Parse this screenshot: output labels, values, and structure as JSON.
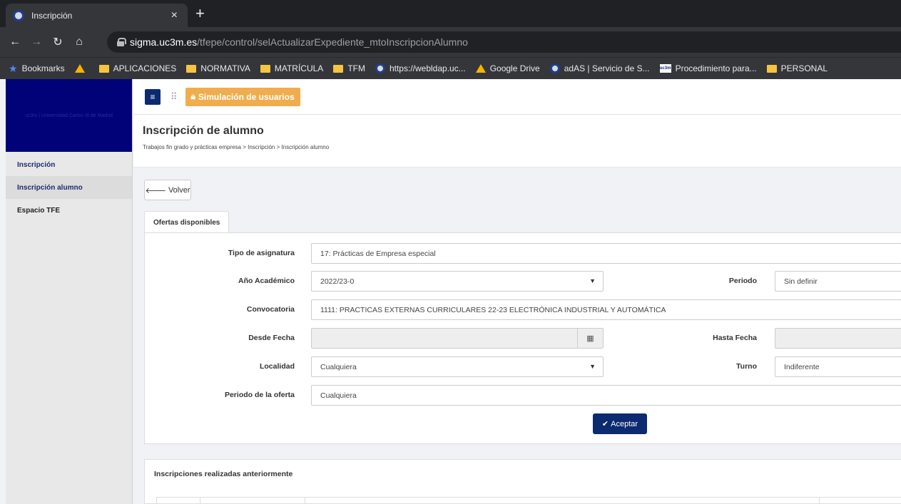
{
  "browser": {
    "tab_title": "Inscripción",
    "close_glyph": "×",
    "newtab_glyph": "+",
    "url_host": "sigma.uc3m.es",
    "url_path": "/tfepe/control/selActualizarExpediente_mtoInscripcionAlumno",
    "bookmarks": [
      {
        "label": "Bookmarks",
        "icon": "star-icon"
      },
      {
        "label": "",
        "icon": "google-drive-icon"
      },
      {
        "label": "APLICACIONES",
        "icon": "folder-icon"
      },
      {
        "label": "NORMATIVA",
        "icon": "folder-icon"
      },
      {
        "label": "MATRÍCULA",
        "icon": "folder-icon"
      },
      {
        "label": "TFM",
        "icon": "folder-icon"
      },
      {
        "label": "https://webldap.uc...",
        "icon": "globe-icon"
      },
      {
        "label": "Google Drive",
        "icon": "google-drive-icon"
      },
      {
        "label": "adAS | Servicio de S...",
        "icon": "globe-icon"
      },
      {
        "label": "Procedimiento para...",
        "icon": "uc3m-icon"
      },
      {
        "label": "PERSONAL",
        "icon": "folder-icon"
      }
    ]
  },
  "sidebar": {
    "brand": "uc3m | Universidad Carlos III de Madrid",
    "items": [
      {
        "label": "Inscripción"
      },
      {
        "label": "Inscripción alumno"
      },
      {
        "label": "Espacio TFE"
      }
    ]
  },
  "topbar": {
    "simulation_label": "Simulación de usuarios"
  },
  "page": {
    "title": "Inscripción de alumno",
    "breadcrumb": "Trabajos fin grado y prácticas empresa > Inscripción > Inscripción alumno",
    "back_label": "Volver",
    "tab_label": "Ofertas disponibles"
  },
  "form": {
    "tipo_label": "Tipo de asignatura",
    "tipo_value": "17: Prácticas de Empresa especial",
    "anio_label": "Año Académico",
    "anio_value": "2022/23-0",
    "periodo_label": "Periodo",
    "periodo_value": "Sin definir",
    "convocatoria_label": "Convocatoria",
    "convocatoria_value": "1111: PRACTICAS EXTERNAS CURRICULARES 22-23 ELECTRÓNICA INDUSTRIAL Y AUTOMÁTICA",
    "desde_label": "Desde Fecha",
    "desde_value": "",
    "hasta_label": "Hasta Fecha",
    "hasta_value": "",
    "localidad_label": "Localidad",
    "localidad_value": "Cualquiera",
    "turno_label": "Turno",
    "turno_value": "Indiferente",
    "periodo_oferta_label": "Periodo de la oferta",
    "periodo_oferta_value": "Cualquiera",
    "accept_label": "Aceptar"
  },
  "previous": {
    "title": "Inscripciones realizadas anteriormente"
  }
}
